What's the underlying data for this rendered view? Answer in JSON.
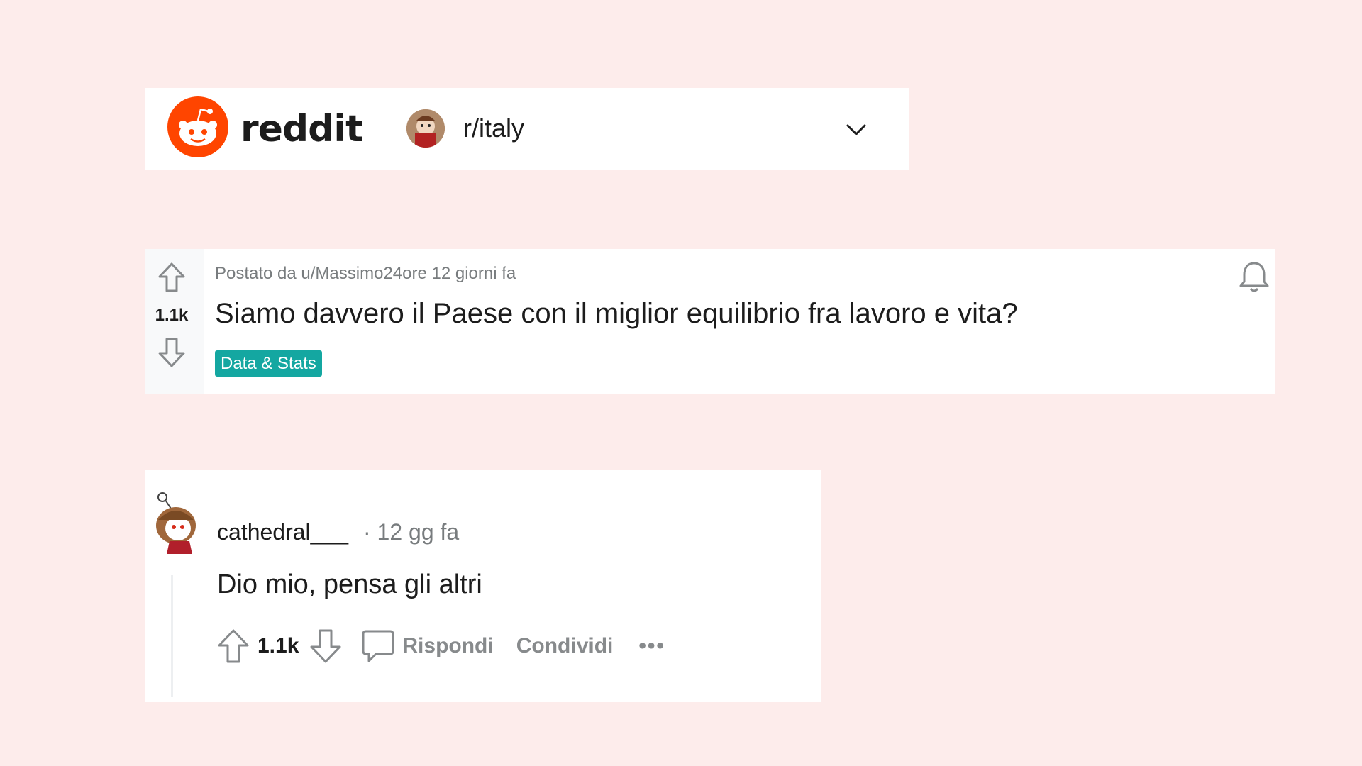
{
  "header": {
    "wordmark": "reddit",
    "subreddit": "r/italy"
  },
  "post": {
    "meta": "Postato da u/Massimo24ore 12 giorni fa",
    "title": "Siamo davvero il Paese con il miglior equilibrio fra lavoro e vita?",
    "vote_count": "1.1k",
    "flair": "Data & Stats"
  },
  "comment": {
    "author": "cathedral___",
    "time": "· 12 gg fa",
    "body": "Dio mio, pensa gli altri",
    "vote_count": "1.1k",
    "reply_label": "Rispondi",
    "share_label": "Condividi",
    "more_label": "•••"
  },
  "colors": {
    "background": "#fdeceb",
    "brand": "#ff4500",
    "flair": "#14a7a1",
    "muted_text": "#787c7e"
  },
  "icons": [
    "reddit-logo",
    "chevron-down-icon",
    "upvote-icon",
    "downvote-icon",
    "bell-icon",
    "comment-icon",
    "more-icon"
  ]
}
